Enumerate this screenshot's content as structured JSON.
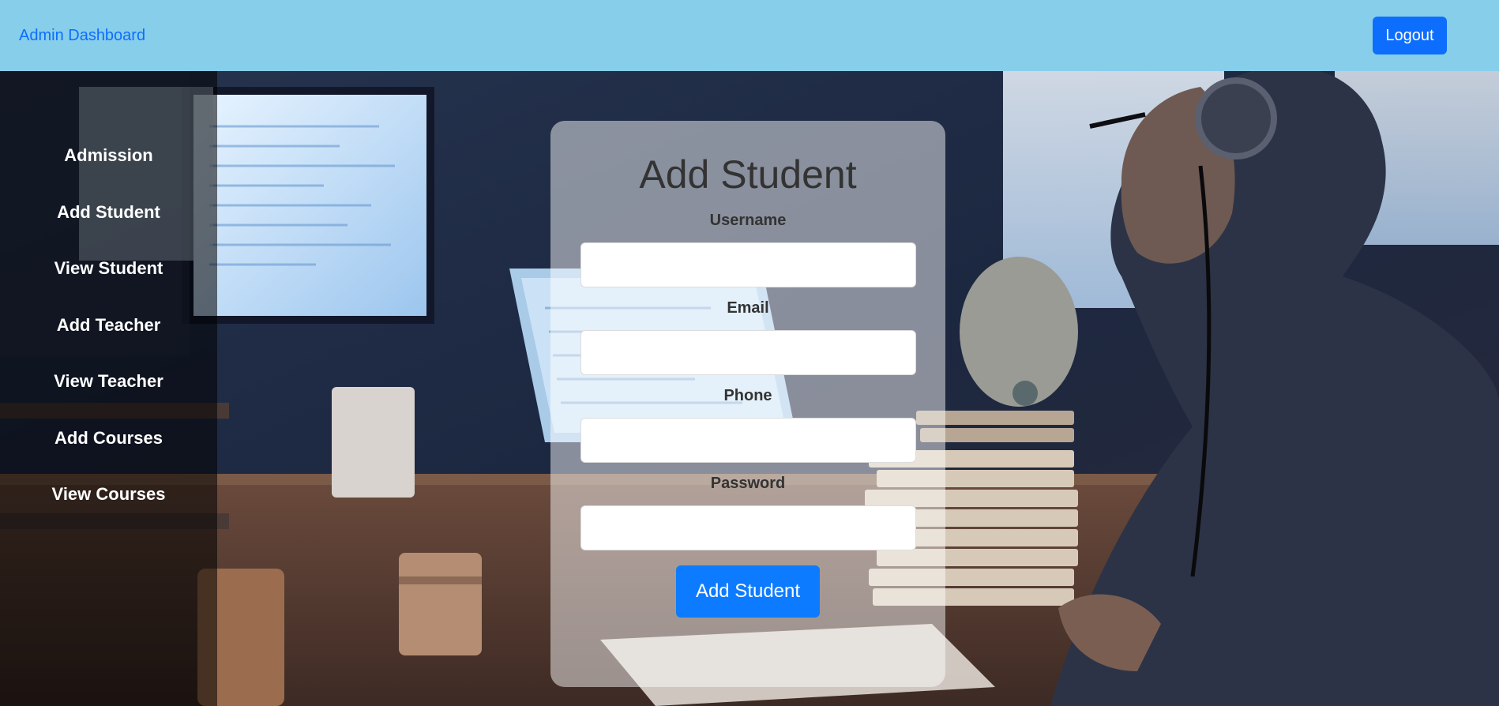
{
  "header": {
    "brand": "Admin Dashboard",
    "logout_label": "Logout"
  },
  "sidebar": {
    "items": [
      {
        "label": "Admission"
      },
      {
        "label": "Add Student"
      },
      {
        "label": "View Student"
      },
      {
        "label": "Add Teacher"
      },
      {
        "label": "View Teacher"
      },
      {
        "label": "Add Courses"
      },
      {
        "label": "View Courses"
      }
    ]
  },
  "form": {
    "title": "Add Student",
    "fields": [
      {
        "label": "Username",
        "value": ""
      },
      {
        "label": "Email",
        "value": ""
      },
      {
        "label": "Phone",
        "value": ""
      },
      {
        "label": "Password",
        "value": ""
      }
    ],
    "submit_label": "Add Student"
  },
  "colors": {
    "header_bg": "#87ceeb",
    "brand_link": "#0d6efd",
    "primary_button": "#0d6efd"
  },
  "background": {
    "icon": "workspace-photo"
  }
}
